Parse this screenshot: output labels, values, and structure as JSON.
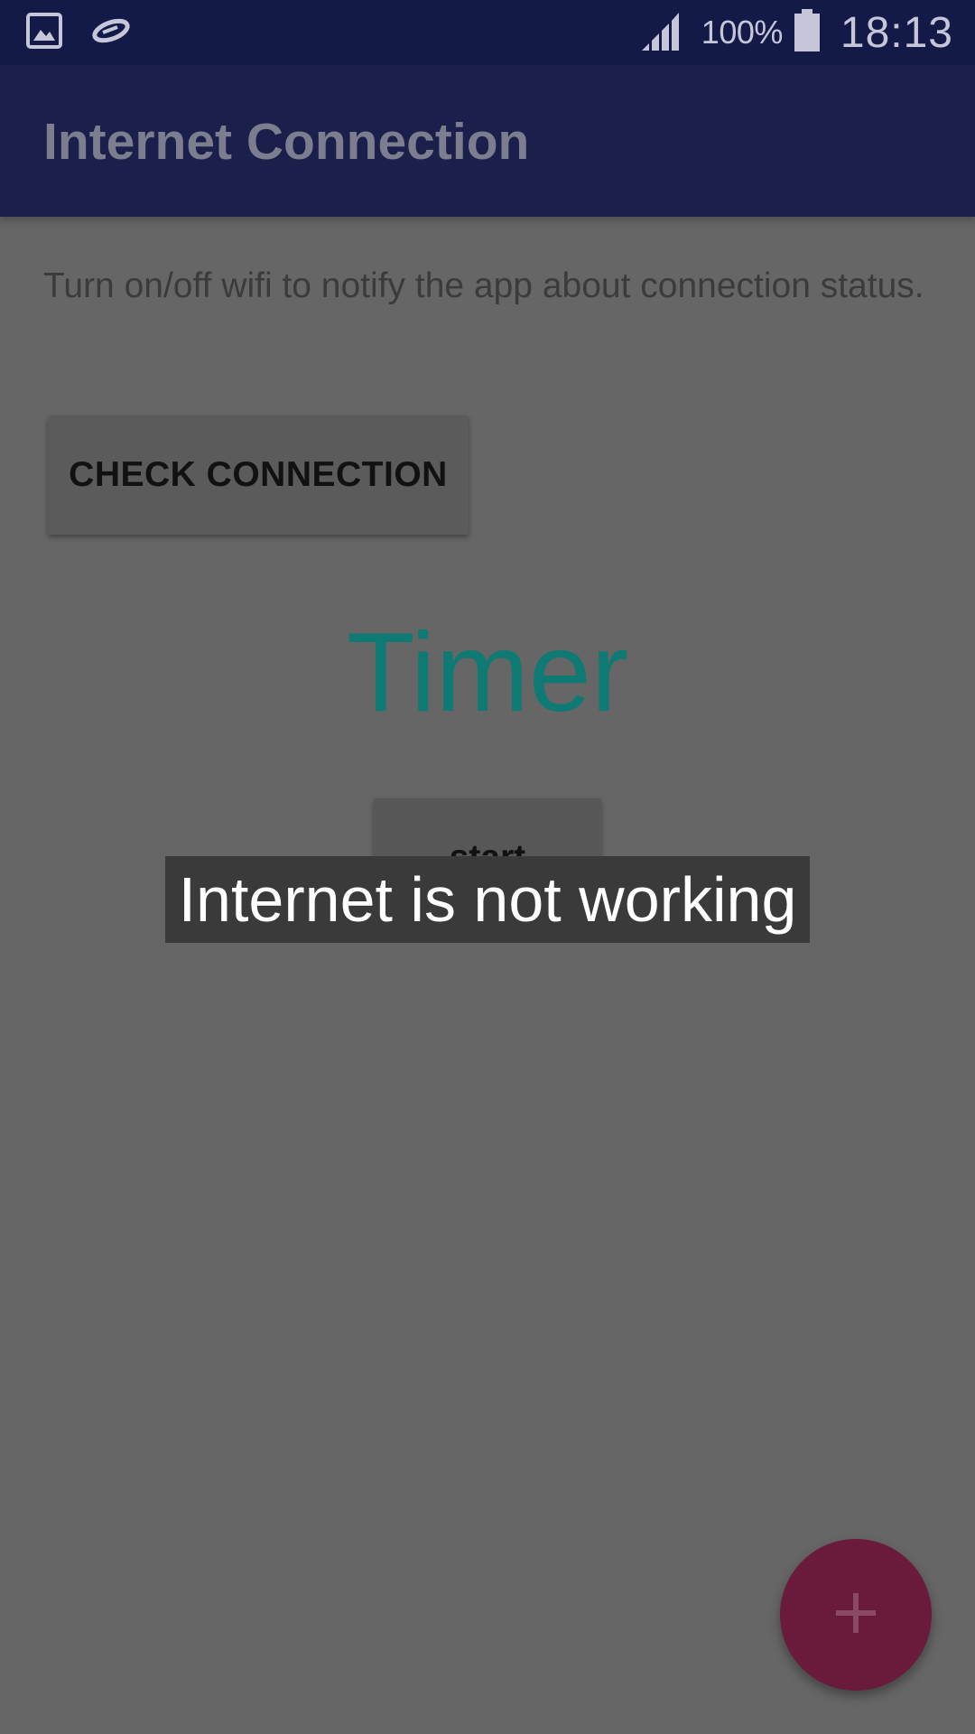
{
  "status_bar": {
    "icons_left": [
      "gallery-icon",
      "sync-icon"
    ],
    "icons_right": [
      "signal-icon",
      "battery-icon"
    ],
    "battery_percent": "100%",
    "time": "18:13"
  },
  "app_bar": {
    "title": "Internet Connection"
  },
  "content": {
    "description": "Turn on/off wifi to notify the app about connection status.",
    "check_button_label": "CHECK CONNECTION",
    "timer_label": "Timer",
    "start_button_label": "start"
  },
  "toast": {
    "message": "Internet is not working"
  },
  "fab": {
    "icon": "plus-icon"
  },
  "colors": {
    "status_bar": "#141a47",
    "app_bar": "#1a1f4b",
    "background_dimmed": "#666666",
    "timer_text": "#0f7a74",
    "fab": "#6a1a3a",
    "toast_background": "#3a3a3a"
  }
}
